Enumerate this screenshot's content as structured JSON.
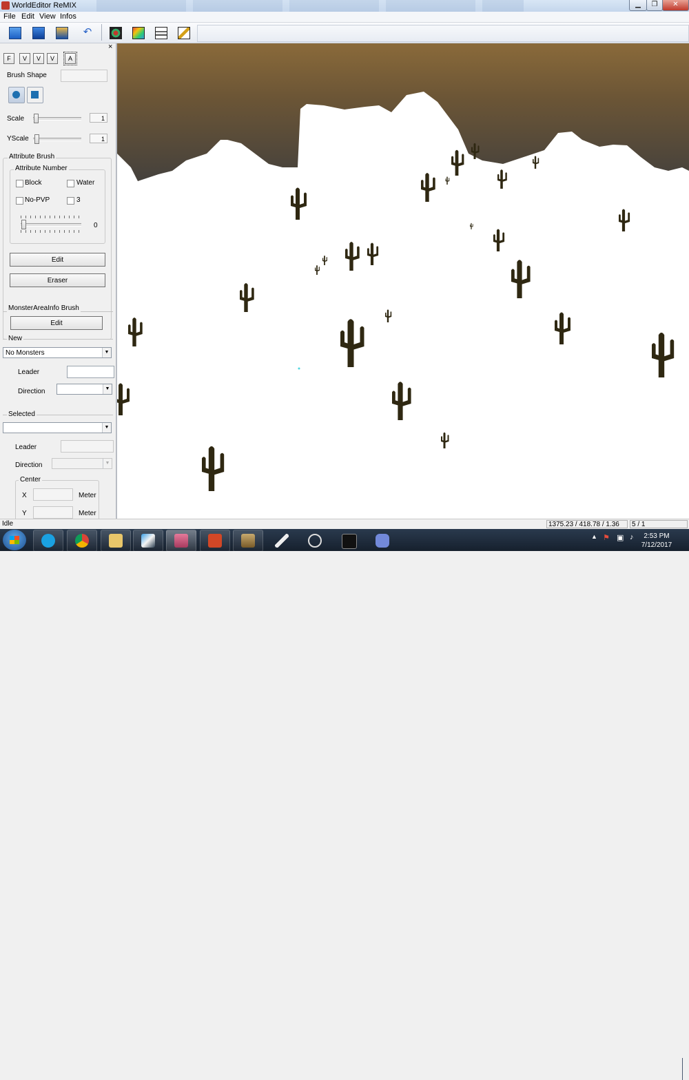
{
  "window": {
    "title": "WorldEditor ReMIX",
    "close_glyph": "✕",
    "min_glyph": "▁",
    "max_glyph": "❐"
  },
  "menu": [
    "File",
    "Edit",
    "View",
    "Infos"
  ],
  "toolbar": {
    "icons": [
      "new-file-icon",
      "open-icon",
      "save-icon",
      "undo-icon",
      "objects-icon",
      "texture-icon",
      "attribute-icon",
      "brush-icon"
    ]
  },
  "panel": {
    "close_glyph": "×",
    "mode_buttons": [
      "F",
      "V",
      "V",
      "V",
      "A"
    ],
    "brush_shape_label": "Brush Shape",
    "scale_label": "Scale",
    "scale_value": "1",
    "yscale_label": "YScale",
    "yscale_value": "1",
    "attribute_brush": {
      "title": "Attribute Brush",
      "attribute_number_title": "Attribute Number",
      "checkboxes": [
        "Block",
        "Water",
        "No-PVP",
        "3"
      ],
      "slider_value": "0",
      "edit_label": "Edit",
      "eraser_label": "Eraser"
    },
    "monster_brush": {
      "title": "MonsterAreaInfo Brush",
      "edit_label": "Edit",
      "new_title": "New",
      "new_select": "No Monsters",
      "leader_label": "Leader",
      "direction_label": "Direction",
      "selected_title": "Selected",
      "sel_leader_label": "Leader",
      "sel_direction_label": "Direction",
      "center_title": "Center",
      "x_label": "X",
      "y_label": "Y",
      "meter_label": "Meter"
    }
  },
  "status": {
    "text": "Idle",
    "coords": "1375.23 / 418.78 / 1.36",
    "page": "5 / 1"
  },
  "taskbar": {
    "time": "2:53 PM",
    "date": "7/12/2017",
    "apps": [
      "skype-icon",
      "chrome-icon",
      "file-explorer-icon",
      "gem-app-icon",
      "anime-app-icon",
      "powerpoint-icon",
      "league-icon",
      "feather-icon",
      "obs-icon",
      "terminal-icon",
      "discord-icon"
    ]
  },
  "colors": {
    "sky_top": "#8a6a3a",
    "sky_bottom": "#3b3c3e",
    "snow": "#ffffff",
    "cactus": "#2f2812",
    "accent": "#1d4f8f"
  }
}
